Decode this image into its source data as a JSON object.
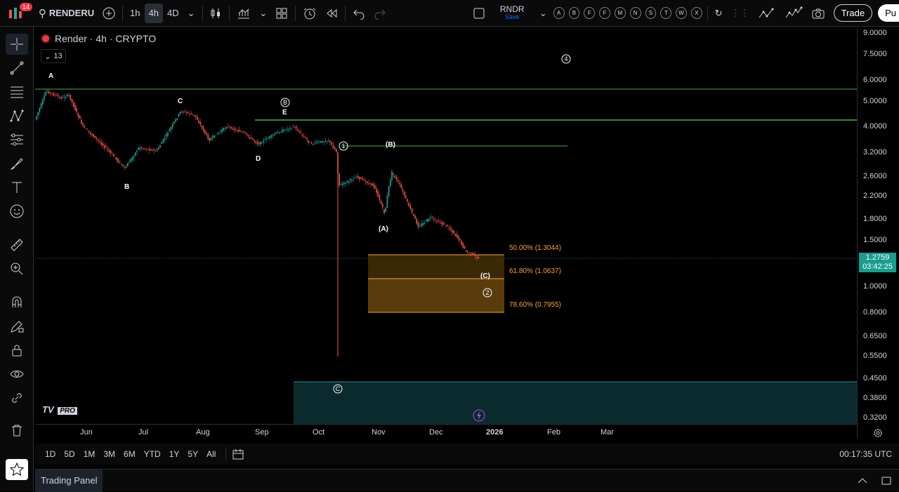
{
  "toolbar": {
    "notification_count": "14",
    "symbol": "RENDERU",
    "intervals": [
      "1h",
      "4h",
      "4D"
    ],
    "active_interval": "4h",
    "compare_symbol": "RNDR",
    "save_label": "Save",
    "letter_buttons": [
      "A",
      "B",
      "F",
      "F",
      "M",
      "N",
      "S",
      "T",
      "W",
      "X"
    ],
    "trade_label": "Trade",
    "publish_label": "Pu"
  },
  "chart": {
    "legend_title": "Render · 4h · CRYPTO",
    "legend_count": "13",
    "tv_logo": "TV",
    "tv_pro": "PRO",
    "wave_labels": {
      "A": "A",
      "B": "B",
      "C": "C",
      "D": "D",
      "E": "E",
      "circB": "B",
      "circ1": "1",
      "circ2": "2",
      "circ4": "4",
      "circC": "C",
      "parB": "(B)",
      "parA": "(A)",
      "parC": "(C)"
    },
    "fib_levels": [
      {
        "label": "50.00% (1.3044)"
      },
      {
        "label": "61.80% (1.0637)"
      },
      {
        "label": "78.60% (0.7955)"
      }
    ]
  },
  "price_axis": {
    "labels": [
      "9.0000",
      "7.5000",
      "6.0000",
      "5.0000",
      "4.0000",
      "3.2000",
      "2.6000",
      "2.2000",
      "1.8000",
      "1.5000",
      "1.0000",
      "0.8000",
      "0.6500",
      "0.5500",
      "0.4500",
      "0.3800",
      "0.3200"
    ],
    "current_price": "1.2759",
    "countdown": "03:42:25"
  },
  "time_axis": {
    "labels": [
      "Jun",
      "Jul",
      "Aug",
      "Sep",
      "Oct",
      "Nov",
      "Dec",
      "2026",
      "Feb",
      "Mar"
    ]
  },
  "bottom": {
    "ranges": [
      "1D",
      "5D",
      "1M",
      "3M",
      "6M",
      "YTD",
      "1Y",
      "5Y",
      "All"
    ],
    "clock": "00:17:35 UTC",
    "panel_tab": "Trading Panel"
  },
  "colors": {
    "up": "#26a69a",
    "down": "#ef5350",
    "fib": "#f7a43f",
    "level_line": "#4caf50",
    "accent": "#1a9c8f"
  }
}
